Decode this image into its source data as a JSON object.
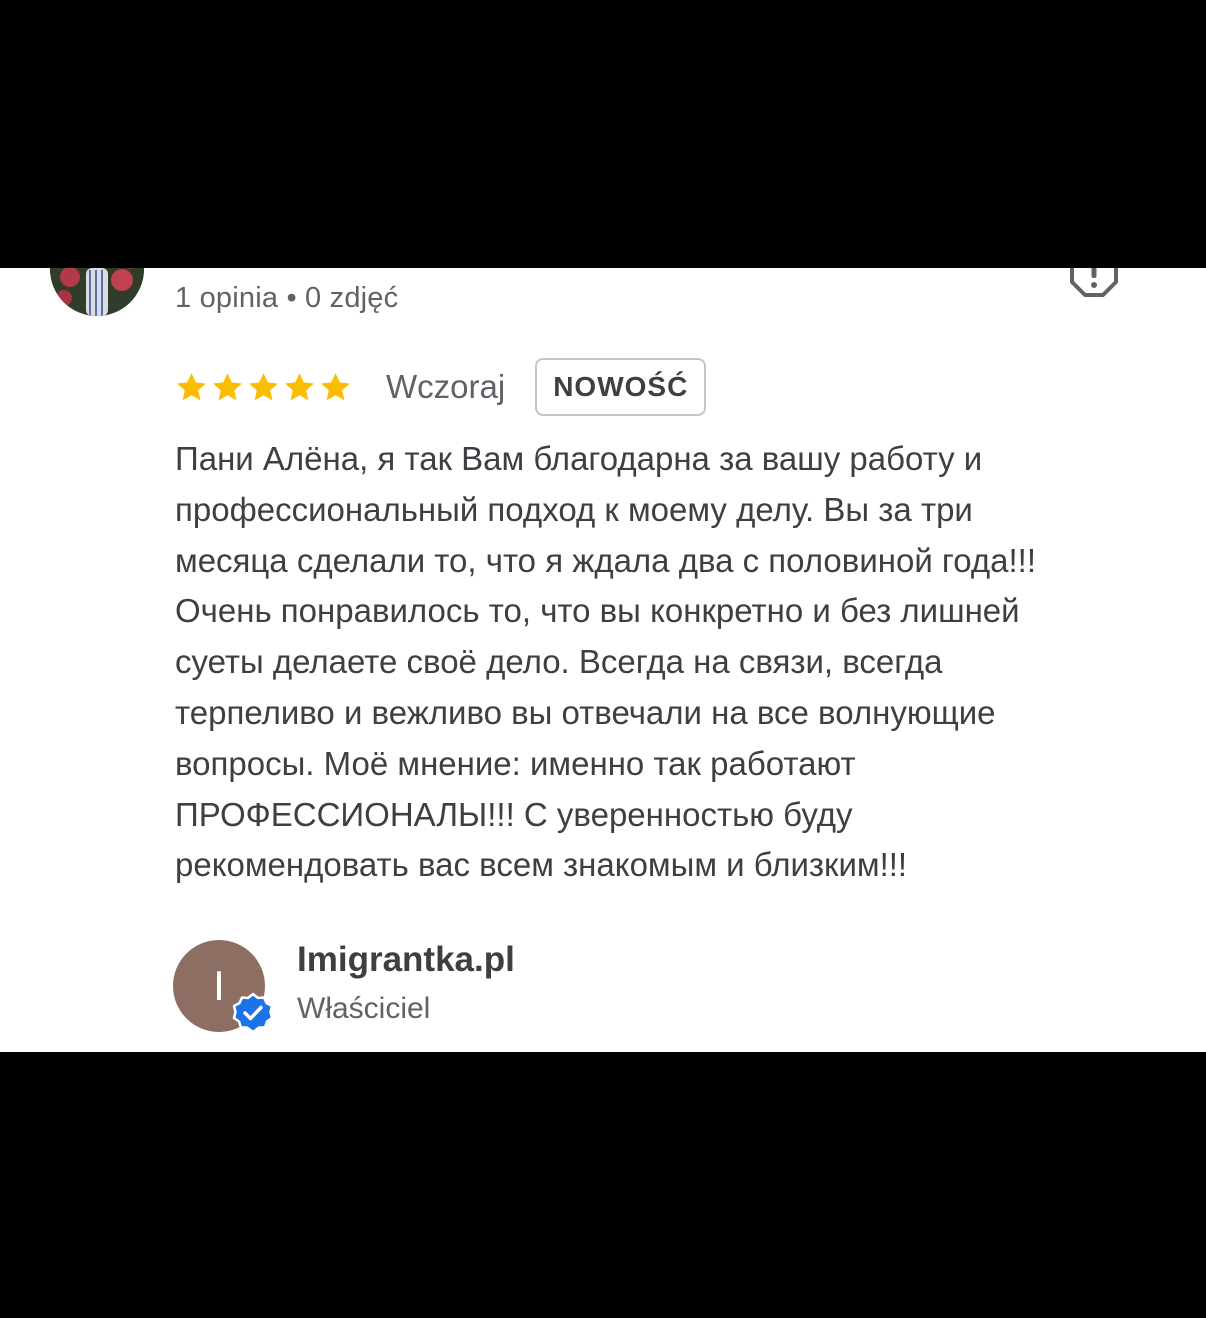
{
  "reviewer": {
    "avatar_icon": "reviewer-photo-avatar",
    "meta": "1 opinia • 0 zdjęć"
  },
  "report_icon": "report-flag-icon",
  "review": {
    "rating": 5,
    "rating_max": 5,
    "star_color": "#fbbc04",
    "date": "Wczoraj",
    "badge": "NOWOŚĆ",
    "text_lines": [
      "Пани Алёна, я так Вам благодарна за вашу работу и",
      "профессиональный подход к моему делу. Вы за три",
      "месяца сделали то, что я ждала два с половиной года!!!",
      "Очень понравилось то, что вы конкретно и без лишней",
      "суеты делаете своё дело. Всегда на связи, всегда",
      "терпеливо и вежливо вы отвечали на все волнующие",
      "вопросы. Моё мнение: именно так работают",
      "ПРОФЕССИОНАЛЫ!!! С уверенностью буду",
      "рекомендовать вас всем знакомым и близким!!!"
    ]
  },
  "owner": {
    "avatar_letter": "I",
    "avatar_color": "#8d6e63",
    "verified_color": "#1a73e8",
    "name": "Imigrantka.pl",
    "role": "Właściciel"
  }
}
